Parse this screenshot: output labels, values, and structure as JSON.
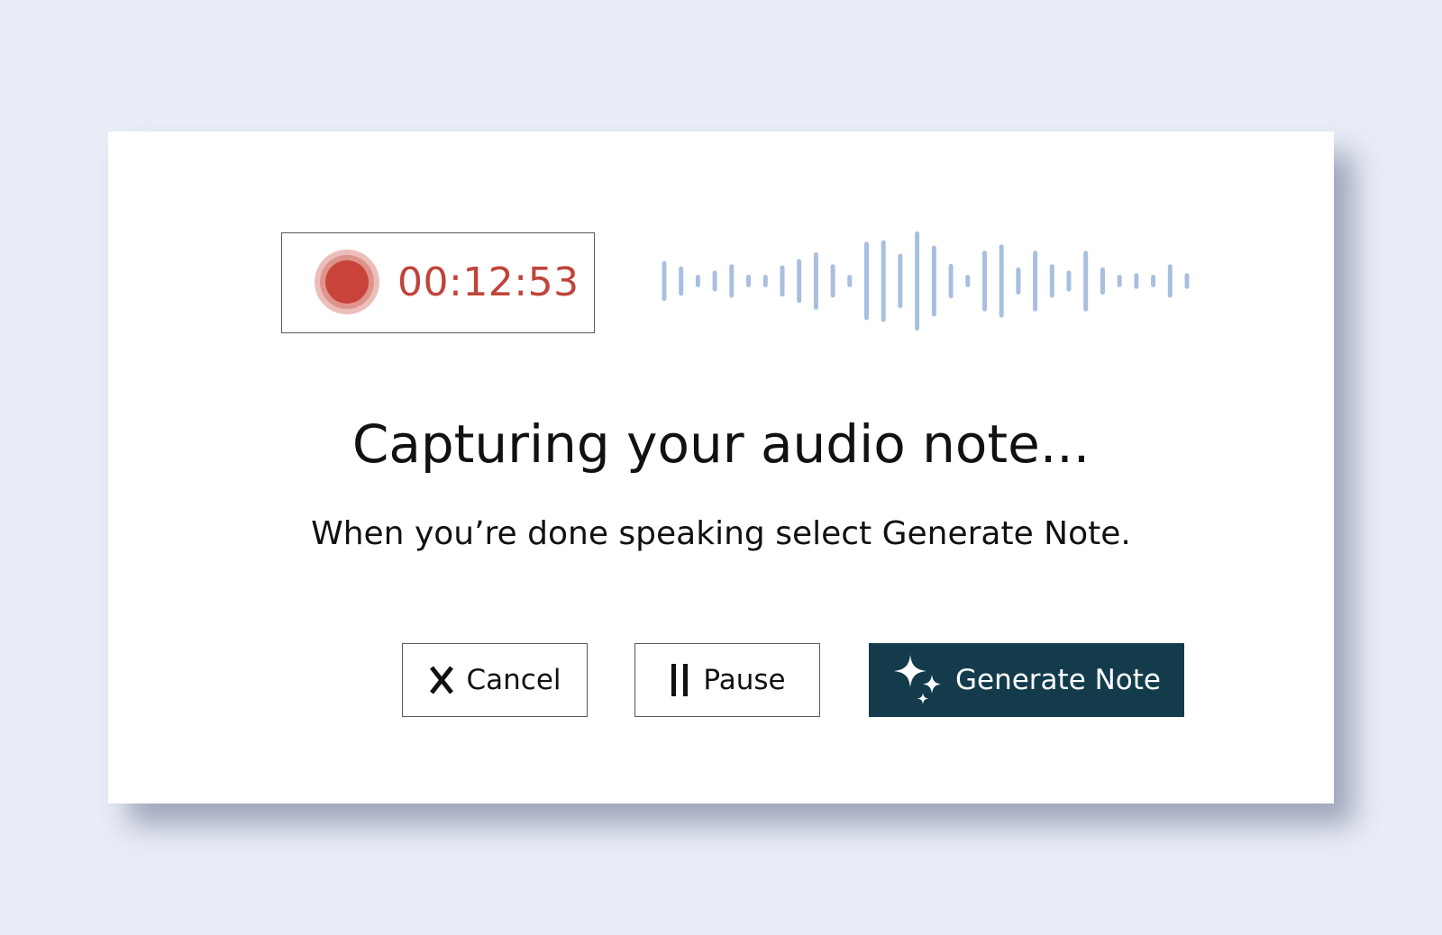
{
  "recorder": {
    "timer": "00:12:53",
    "status_icon": "record-icon",
    "accent_color": "#c8443a",
    "waveform_color": "#a9bfe0",
    "waveform_levels": [
      0.38,
      0.28,
      0.12,
      0.2,
      0.32,
      0.12,
      0.12,
      0.3,
      0.42,
      0.55,
      0.32,
      0.12,
      0.75,
      0.78,
      0.52,
      0.95,
      0.68,
      0.33,
      0.12,
      0.58,
      0.7,
      0.26,
      0.58,
      0.32,
      0.2,
      0.58,
      0.26,
      0.12,
      0.15,
      0.12,
      0.32,
      0.15
    ]
  },
  "dialog": {
    "title": "Capturing your audio note...",
    "subtitle": "When you’re done speaking select Generate Note."
  },
  "actions": {
    "cancel_label": "Cancel",
    "cancel_icon": "close-icon",
    "pause_label": "Pause",
    "pause_icon": "pause-icon",
    "generate_label": "Generate Note",
    "generate_icon": "sparkle-icon",
    "generate_color": "#133b4c"
  }
}
